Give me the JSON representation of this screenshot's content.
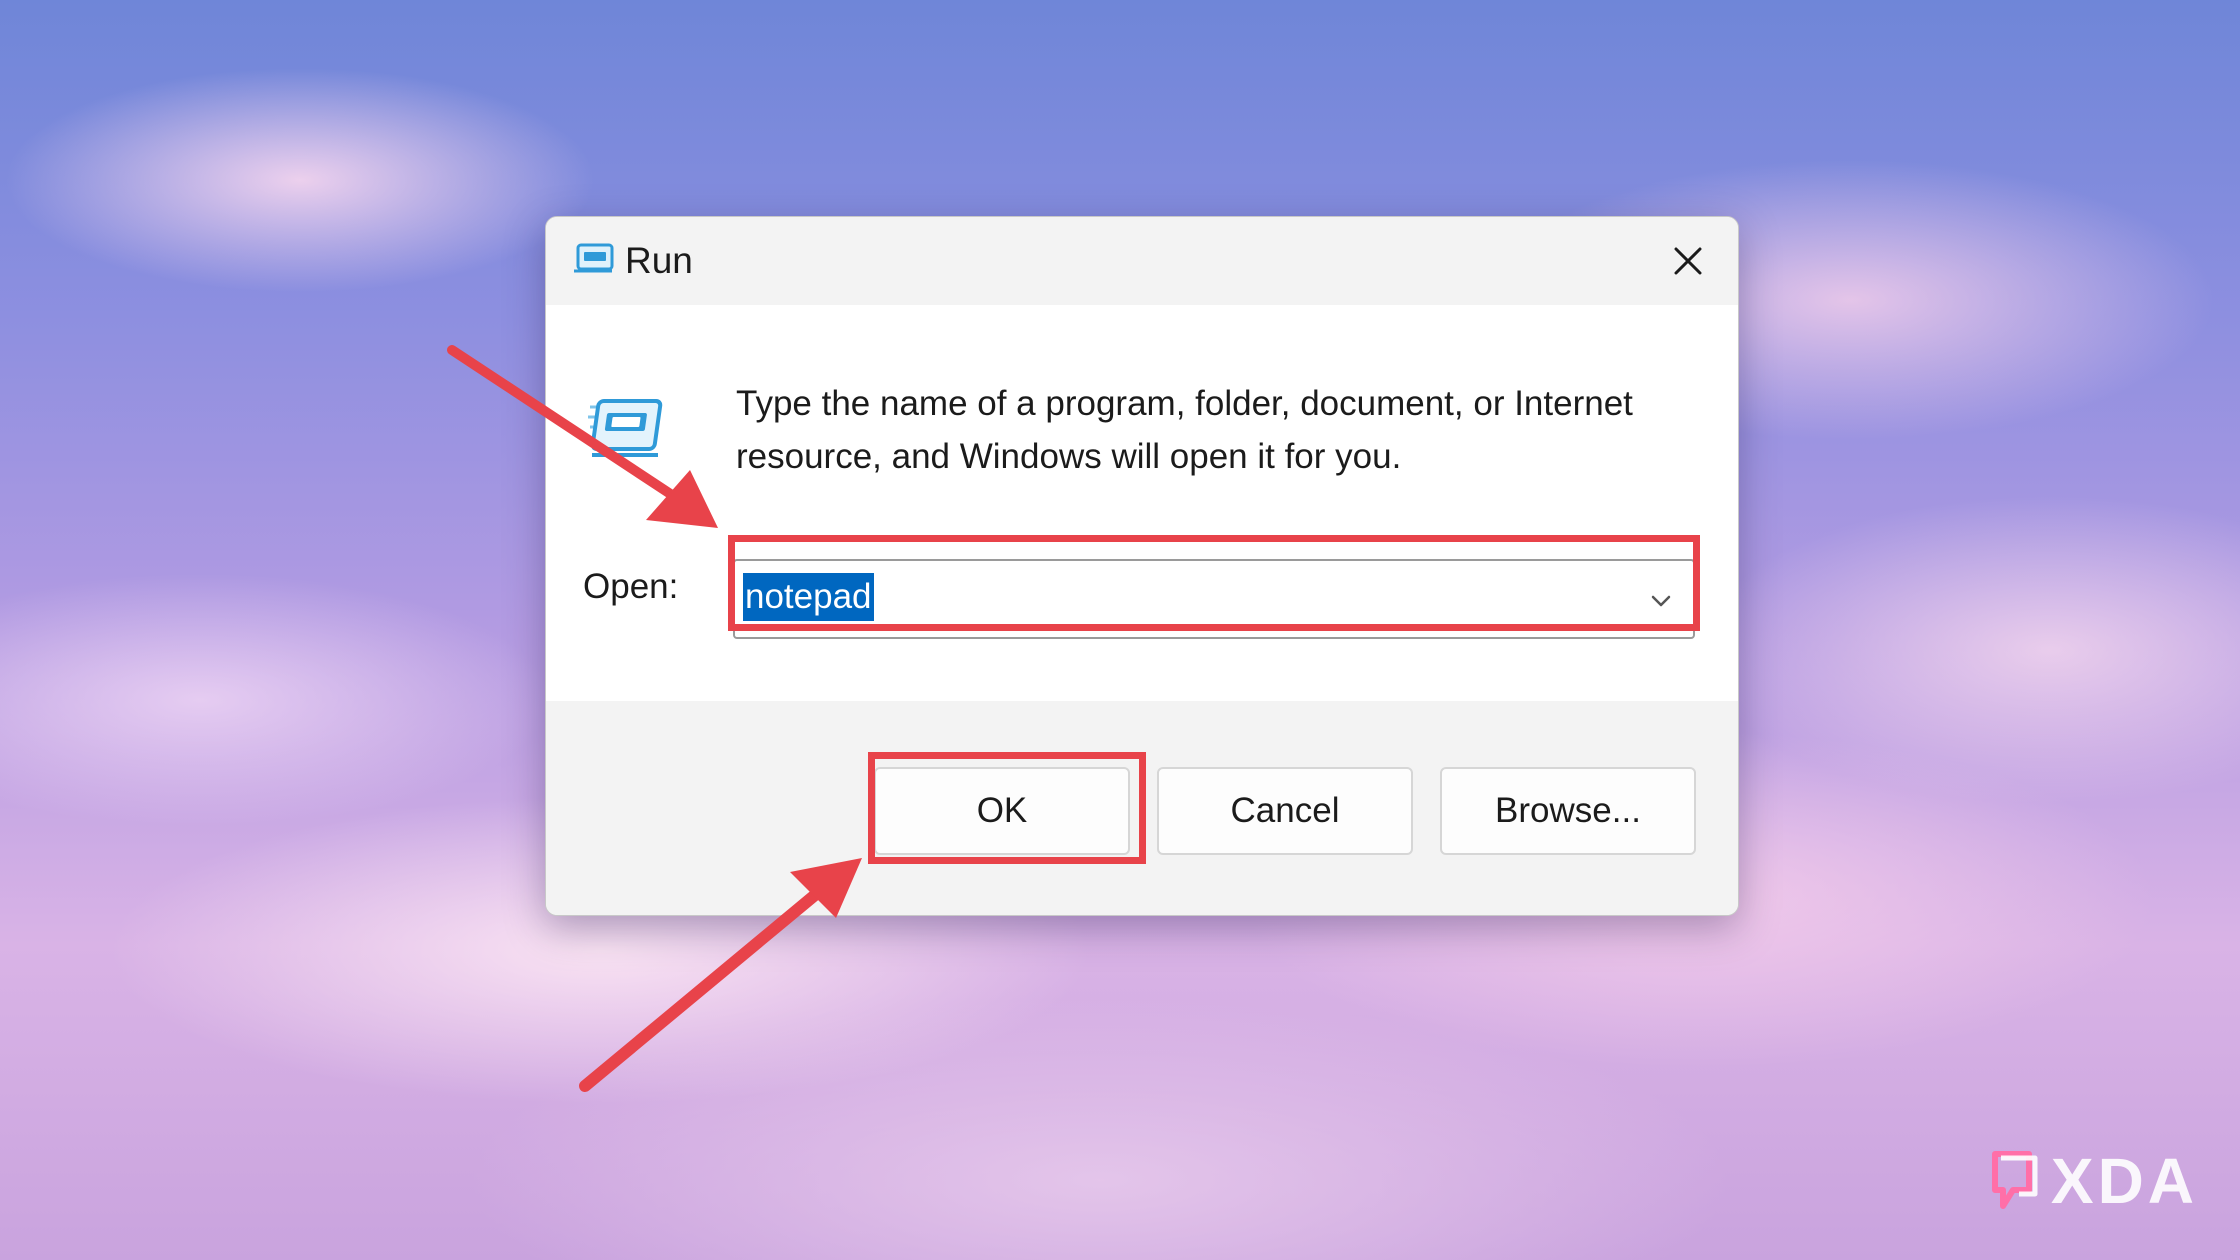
{
  "dialog": {
    "title": "Run",
    "description": "Type the name of a program, folder, document, or Internet resource, and Windows will open it for you.",
    "open_label": "Open:",
    "open_value": "notepad",
    "buttons": {
      "ok": "OK",
      "cancel": "Cancel",
      "browse": "Browse..."
    }
  },
  "watermark": {
    "text": "XDA"
  },
  "colors": {
    "highlight": "#e8434a",
    "selection": "#0067c0",
    "run_icon": "#2f9ad8"
  },
  "icons": [
    "run-icon",
    "close-icon",
    "chevron-down-icon",
    "xda-logo-icon"
  ]
}
